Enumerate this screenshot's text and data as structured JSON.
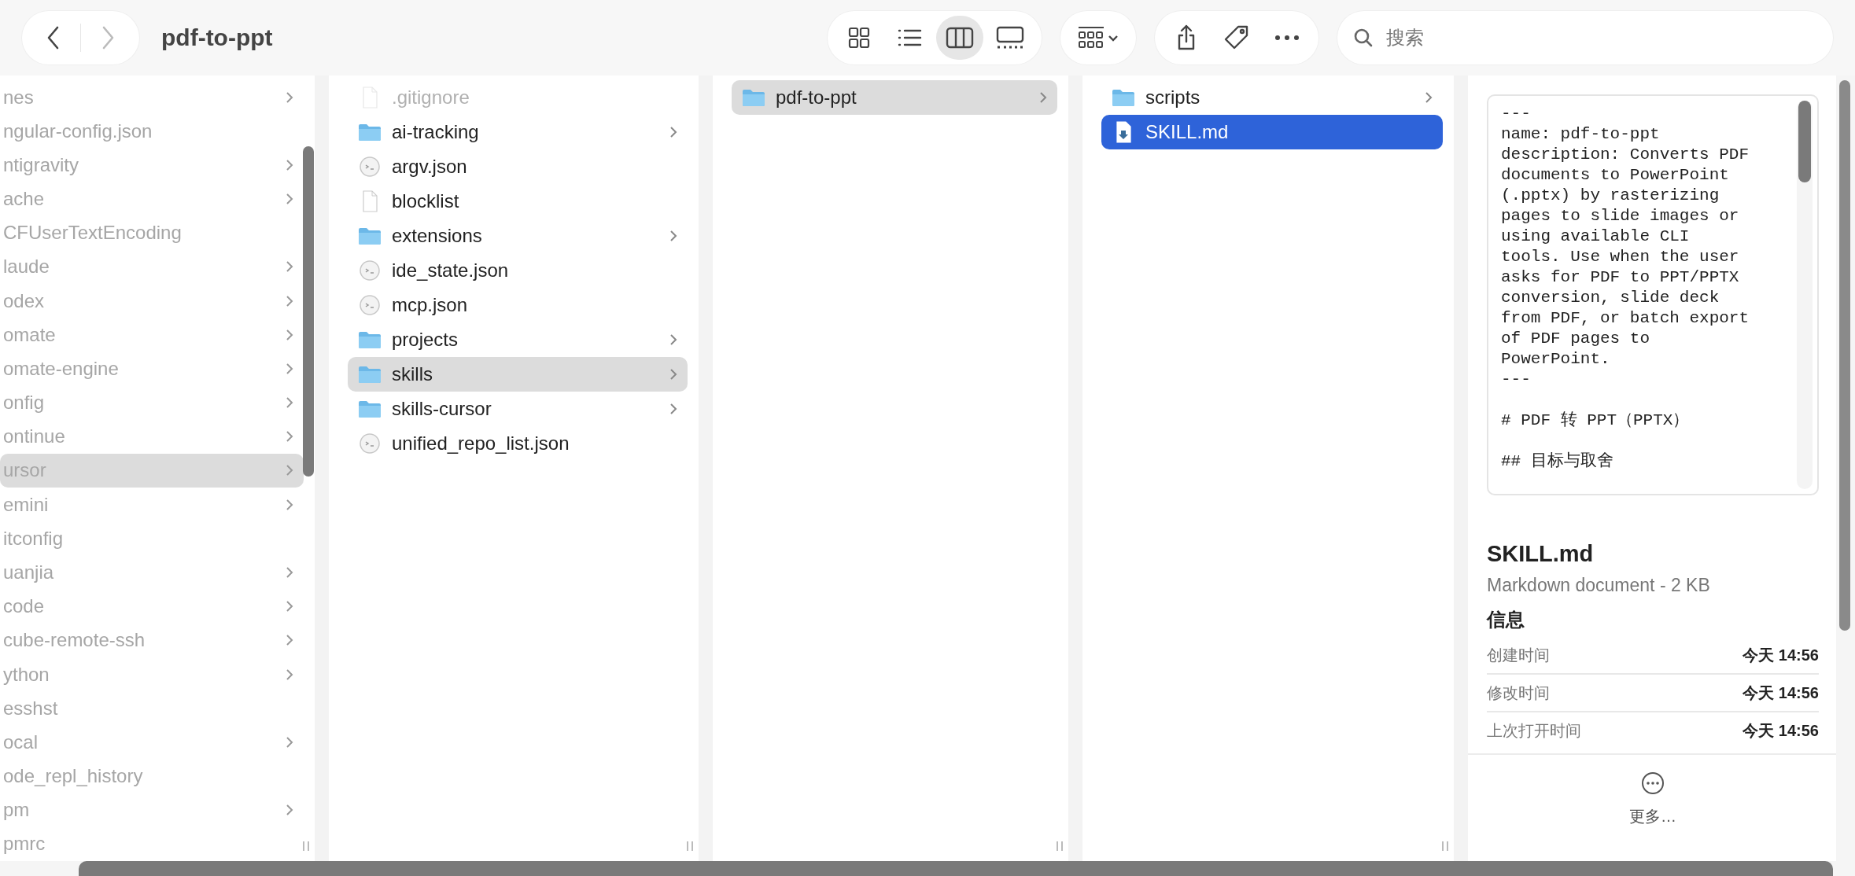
{
  "toolbar": {
    "back": {
      "disabled": false
    },
    "forward": {
      "disabled": true
    },
    "title": "pdf-to-ppt",
    "views": [
      {
        "kind": "icons",
        "selected": false
      },
      {
        "kind": "list",
        "selected": false
      },
      {
        "kind": "columns",
        "selected": true
      },
      {
        "kind": "gallery",
        "selected": false
      }
    ],
    "search": {
      "placeholder": "搜索"
    }
  },
  "columns": [
    {
      "faded": true,
      "focused": false,
      "items": [
        {
          "name": "nes",
          "kind": "folder",
          "selected": false
        },
        {
          "name": "ngular-config.json",
          "kind": "file",
          "selected": false
        },
        {
          "name": "ntigravity",
          "kind": "folder",
          "selected": false
        },
        {
          "name": "ache",
          "kind": "folder",
          "selected": false
        },
        {
          "name": "CFUserTextEncoding",
          "kind": "file",
          "selected": false
        },
        {
          "name": "laude",
          "kind": "folder",
          "selected": false
        },
        {
          "name": "odex",
          "kind": "folder",
          "selected": false
        },
        {
          "name": "omate",
          "kind": "folder",
          "selected": false
        },
        {
          "name": "omate-engine",
          "kind": "folder",
          "selected": false
        },
        {
          "name": "onfig",
          "kind": "folder",
          "selected": false
        },
        {
          "name": "ontinue",
          "kind": "folder",
          "selected": false
        },
        {
          "name": "ursor",
          "kind": "folder",
          "selected": true
        },
        {
          "name": "emini",
          "kind": "folder",
          "selected": false
        },
        {
          "name": "itconfig",
          "kind": "file",
          "selected": false
        },
        {
          "name": "uanjia",
          "kind": "folder",
          "selected": false
        },
        {
          "name": "code",
          "kind": "folder",
          "selected": false
        },
        {
          "name": "cube-remote-ssh",
          "kind": "folder",
          "selected": false
        },
        {
          "name": "ython",
          "kind": "folder",
          "selected": false
        },
        {
          "name": "esshst",
          "kind": "file",
          "selected": false
        },
        {
          "name": "ocal",
          "kind": "folder",
          "selected": false
        },
        {
          "name": "ode_repl_history",
          "kind": "file",
          "selected": false
        },
        {
          "name": "pm",
          "kind": "folder",
          "selected": false
        },
        {
          "name": "pmrc",
          "kind": "file",
          "selected": false
        }
      ]
    },
    {
      "faded": false,
      "focused": false,
      "items": [
        {
          "name": ".gitignore",
          "kind": "file",
          "dimmed": true,
          "selected": false
        },
        {
          "name": "ai-tracking",
          "kind": "folder",
          "dimmed": false,
          "selected": false
        },
        {
          "name": "argv.json",
          "kind": "json",
          "dimmed": false,
          "selected": false
        },
        {
          "name": "blocklist",
          "kind": "file",
          "dimmed": false,
          "selected": false
        },
        {
          "name": "extensions",
          "kind": "folder",
          "dimmed": false,
          "selected": false
        },
        {
          "name": "ide_state.json",
          "kind": "json",
          "dimmed": false,
          "selected": false
        },
        {
          "name": "mcp.json",
          "kind": "json",
          "dimmed": false,
          "selected": false
        },
        {
          "name": "projects",
          "kind": "folder",
          "dimmed": false,
          "selected": false
        },
        {
          "name": "skills",
          "kind": "folder",
          "dimmed": false,
          "selected": true
        },
        {
          "name": "skills-cursor",
          "kind": "folder",
          "dimmed": false,
          "selected": false
        },
        {
          "name": "unified_repo_list.json",
          "kind": "json",
          "dimmed": false,
          "selected": false
        }
      ]
    },
    {
      "faded": false,
      "focused": false,
      "items": [
        {
          "name": "pdf-to-ppt",
          "kind": "folder",
          "selected": true
        }
      ]
    },
    {
      "faded": false,
      "focused": true,
      "items": [
        {
          "name": "scripts",
          "kind": "folder",
          "selected": false
        },
        {
          "name": "SKILL.md",
          "kind": "markdown",
          "selected": true
        }
      ]
    }
  ],
  "preview": {
    "text": "---\nname: pdf-to-ppt\ndescription: Converts PDF\ndocuments to PowerPoint\n(.pptx) by rasterizing\npages to slide images or\nusing available CLI\ntools. Use when the user\nasks for PDF to PPT/PPTX\nconversion, slide deck\nfrom PDF, or batch export\nof PDF pages to\nPowerPoint.\n---\n\n# PDF 转 PPT（PPTX）\n\n## 目标与取舍",
    "file_name": "SKILL.md",
    "file_type": "Markdown document - 2 KB",
    "info_heading": "信息",
    "info": [
      {
        "label": "创建时间",
        "value": "今天 14:56"
      },
      {
        "label": "修改时间",
        "value": "今天 14:56"
      },
      {
        "label": "上次打开时间",
        "value": "今天 14:56"
      }
    ],
    "more": "更多…"
  }
}
